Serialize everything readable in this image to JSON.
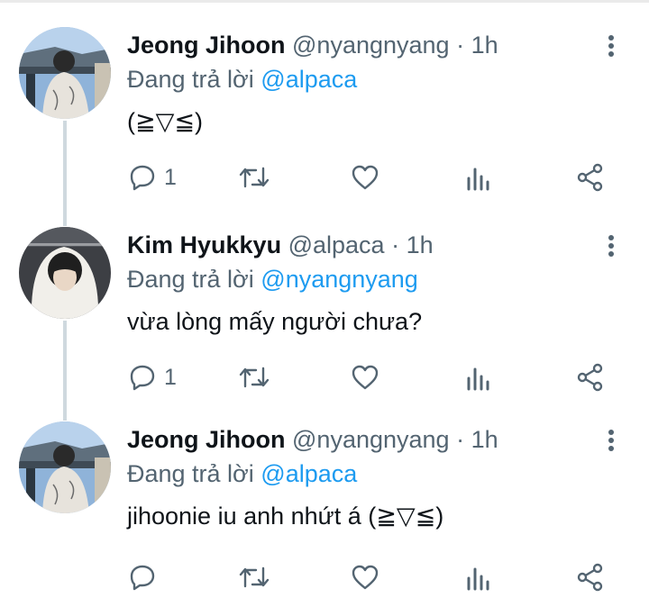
{
  "tweets": [
    {
      "name": "Jeong Jihoon",
      "handle": "@nyangnyang",
      "separator": "·",
      "time": "1h",
      "reply_prefix": "Đang trả lời",
      "reply_to": "@alpaca",
      "text": "(≧▽≦)",
      "reply_count": "1",
      "avatar": "avatar-jeong-jihoon"
    },
    {
      "name": "Kim Hyukkyu",
      "handle": "@alpaca",
      "separator": "·",
      "time": "1h",
      "reply_prefix": "Đang trả lời",
      "reply_to": "@nyangnyang",
      "text": "vừa lòng mấy người chưa?",
      "reply_count": "1",
      "avatar": "avatar-kim-hyukkyu"
    },
    {
      "name": "Jeong Jihoon",
      "handle": "@nyangnyang",
      "separator": "·",
      "time": "1h",
      "reply_prefix": "Đang trả lời",
      "reply_to": "@alpaca",
      "text": "jihoonie iu anh nhứt á (≧▽≦)",
      "reply_count": "",
      "avatar": "avatar-jeong-jihoon"
    }
  ],
  "icons": {
    "reply": "comment-icon",
    "retweet": "retweet-icon",
    "like": "heart-icon",
    "views": "analytics-icon",
    "share": "share-icon",
    "more": "more-vertical-icon"
  },
  "colors": {
    "text": "#0f1419",
    "secondary": "#536471",
    "mention": "#1d9bf0",
    "thread_line": "#cfd9de"
  }
}
